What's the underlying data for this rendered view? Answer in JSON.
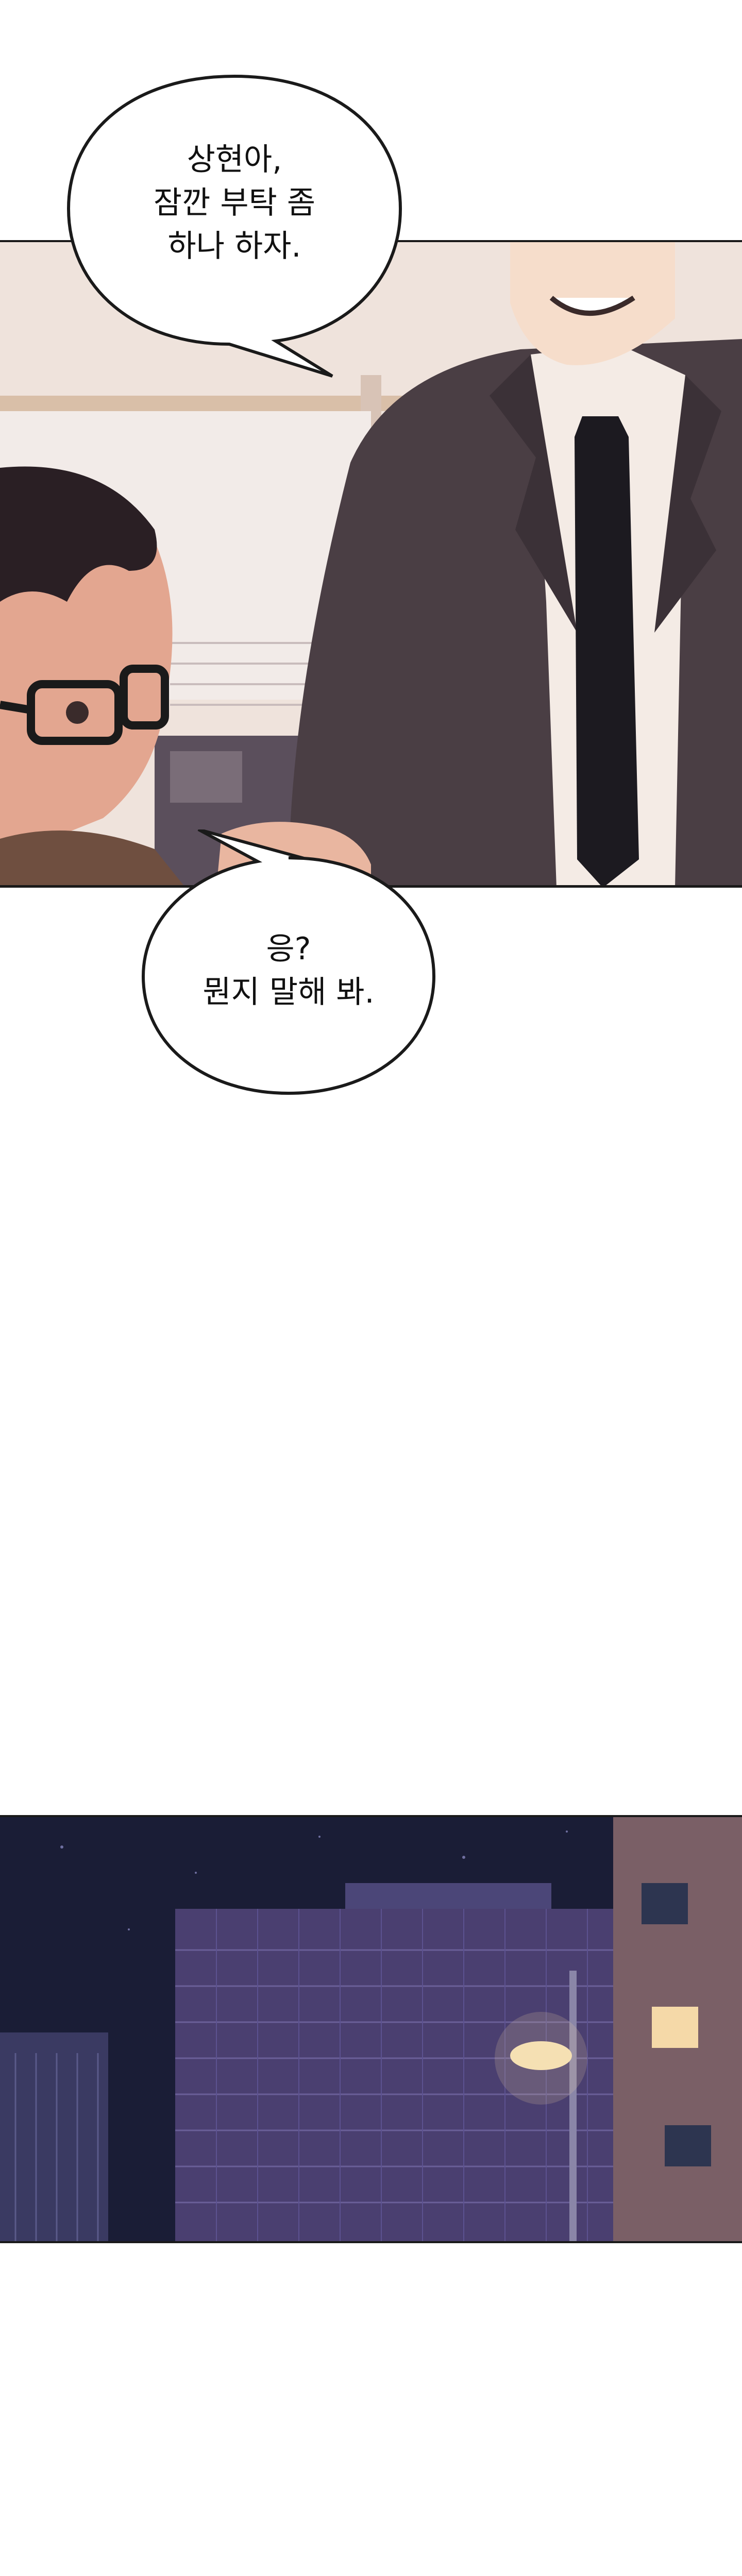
{
  "panels": [
    {
      "scene": "office-conversation",
      "bubbles": [
        {
          "speaker": "suited-man",
          "lines": [
            "상현아,",
            "잠깐 부탁 좀",
            "하나 하자."
          ]
        }
      ]
    },
    {
      "bubbles": [
        {
          "speaker": "glasses-man",
          "lines": [
            "응?",
            "뭔지 말해 봐."
          ]
        }
      ]
    },
    {
      "scene": "night-city-buildings"
    }
  ],
  "colors": {
    "bubble_fill": "#ffffff",
    "bubble_stroke": "#1a1a1a",
    "suit": "#4a3e44",
    "tie": "#1c1a20",
    "night_sky": "#1a1d36",
    "building": "#4a3f70",
    "window_lit": "#f5d9a8"
  }
}
